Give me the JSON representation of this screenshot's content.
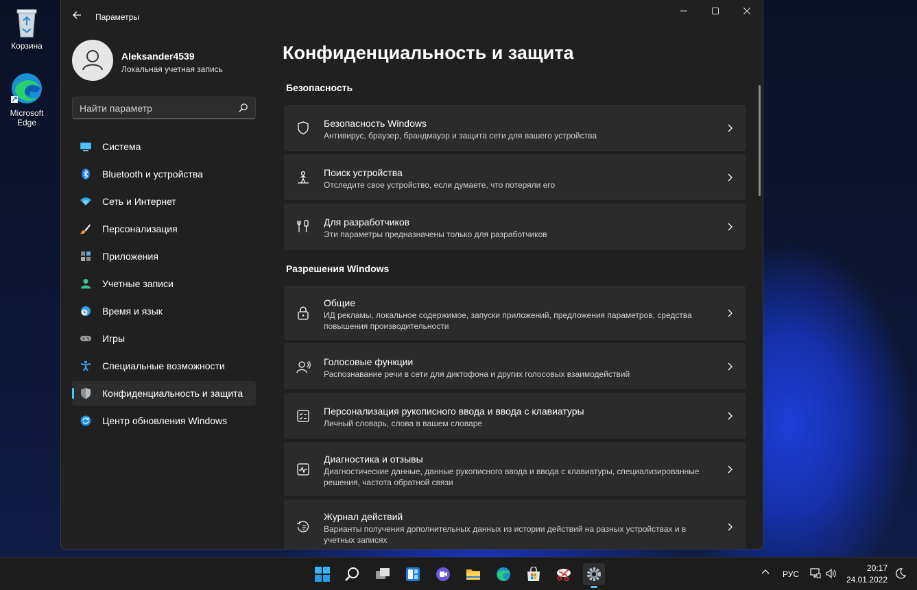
{
  "desktop": {
    "icons": [
      {
        "label": "Корзина"
      },
      {
        "label": "Microsoft Edge"
      }
    ]
  },
  "window": {
    "title": "Параметры",
    "controls": {
      "minimize": "—",
      "maximize": "☐",
      "close": "✕"
    }
  },
  "profile": {
    "name": "Aleksander4539",
    "account_type": "Локальная учетная запись"
  },
  "search": {
    "placeholder": "Найти параметр"
  },
  "sidebar": {
    "items": [
      {
        "label": "Система",
        "icon": "monitor-icon"
      },
      {
        "label": "Bluetooth и устройства",
        "icon": "bluetooth-icon"
      },
      {
        "label": "Сеть и Интернет",
        "icon": "wifi-icon"
      },
      {
        "label": "Персонализация",
        "icon": "brush-icon"
      },
      {
        "label": "Приложения",
        "icon": "apps-icon"
      },
      {
        "label": "Учетные записи",
        "icon": "person-icon"
      },
      {
        "label": "Время и язык",
        "icon": "globe-clock-icon"
      },
      {
        "label": "Игры",
        "icon": "gamepad-icon"
      },
      {
        "label": "Специальные возможности",
        "icon": "accessibility-icon"
      },
      {
        "label": "Конфиденциальность и защита",
        "icon": "shield-icon",
        "active": true
      },
      {
        "label": "Центр обновления Windows",
        "icon": "update-icon"
      }
    ]
  },
  "main": {
    "title": "Конфиденциальность и защита",
    "sections": [
      {
        "title": "Безопасность",
        "cards": [
          {
            "title": "Безопасность Windows",
            "description": "Антивирус, браузер, брандмауэр и защита сети для вашего устройства",
            "icon": "shield-outline-icon"
          },
          {
            "title": "Поиск устройства",
            "description": "Отследите свое устройство, если думаете, что потеряли его",
            "icon": "locate-person-icon"
          },
          {
            "title": "Для разработчиков",
            "description": "Эти параметры предназначены только для разработчиков",
            "icon": "tools-icon"
          }
        ]
      },
      {
        "title": "Разрешения Windows",
        "cards": [
          {
            "title": "Общие",
            "description": "ИД рекламы, локальное содержимое, запуски приложений, предложения параметров, средства повышения производительности",
            "icon": "lock-icon"
          },
          {
            "title": "Голосовые функции",
            "description": "Распознавание речи в сети для диктофона и других голосовых взаимодействий",
            "icon": "voice-icon"
          },
          {
            "title": "Персонализация рукописного ввода и ввода с клавиатуры",
            "description": "Личный словарь, слова в вашем словаре",
            "icon": "checklist-icon"
          },
          {
            "title": "Диагностика и отзывы",
            "description": "Диагностические данные, данные рукописного ввода и ввода с клавиатуры, специализированные решения, частота обратной связи",
            "icon": "diagnostics-icon"
          },
          {
            "title": "Журнал действий",
            "description": "Варианты получения дополнительных данных из истории действий на разных устройствах и в учетных записях",
            "icon": "history-icon"
          }
        ]
      }
    ]
  },
  "taskbar": {
    "apps": [
      "start-icon",
      "search-icon",
      "task-view-icon",
      "widgets-icon",
      "teams-chat-icon",
      "file-explorer-icon",
      "edge-icon",
      "store-icon",
      "snipping-icon",
      "settings-icon"
    ],
    "active_app": "settings-icon",
    "tray": {
      "language": "РУС",
      "time": "20:17",
      "date": "24.01.2022"
    }
  },
  "colors": {
    "accent": "#4cc2ff",
    "window_bg": "#202020",
    "card_bg": "#2b2b2b",
    "taskbar_bg": "#1c1c1c"
  }
}
